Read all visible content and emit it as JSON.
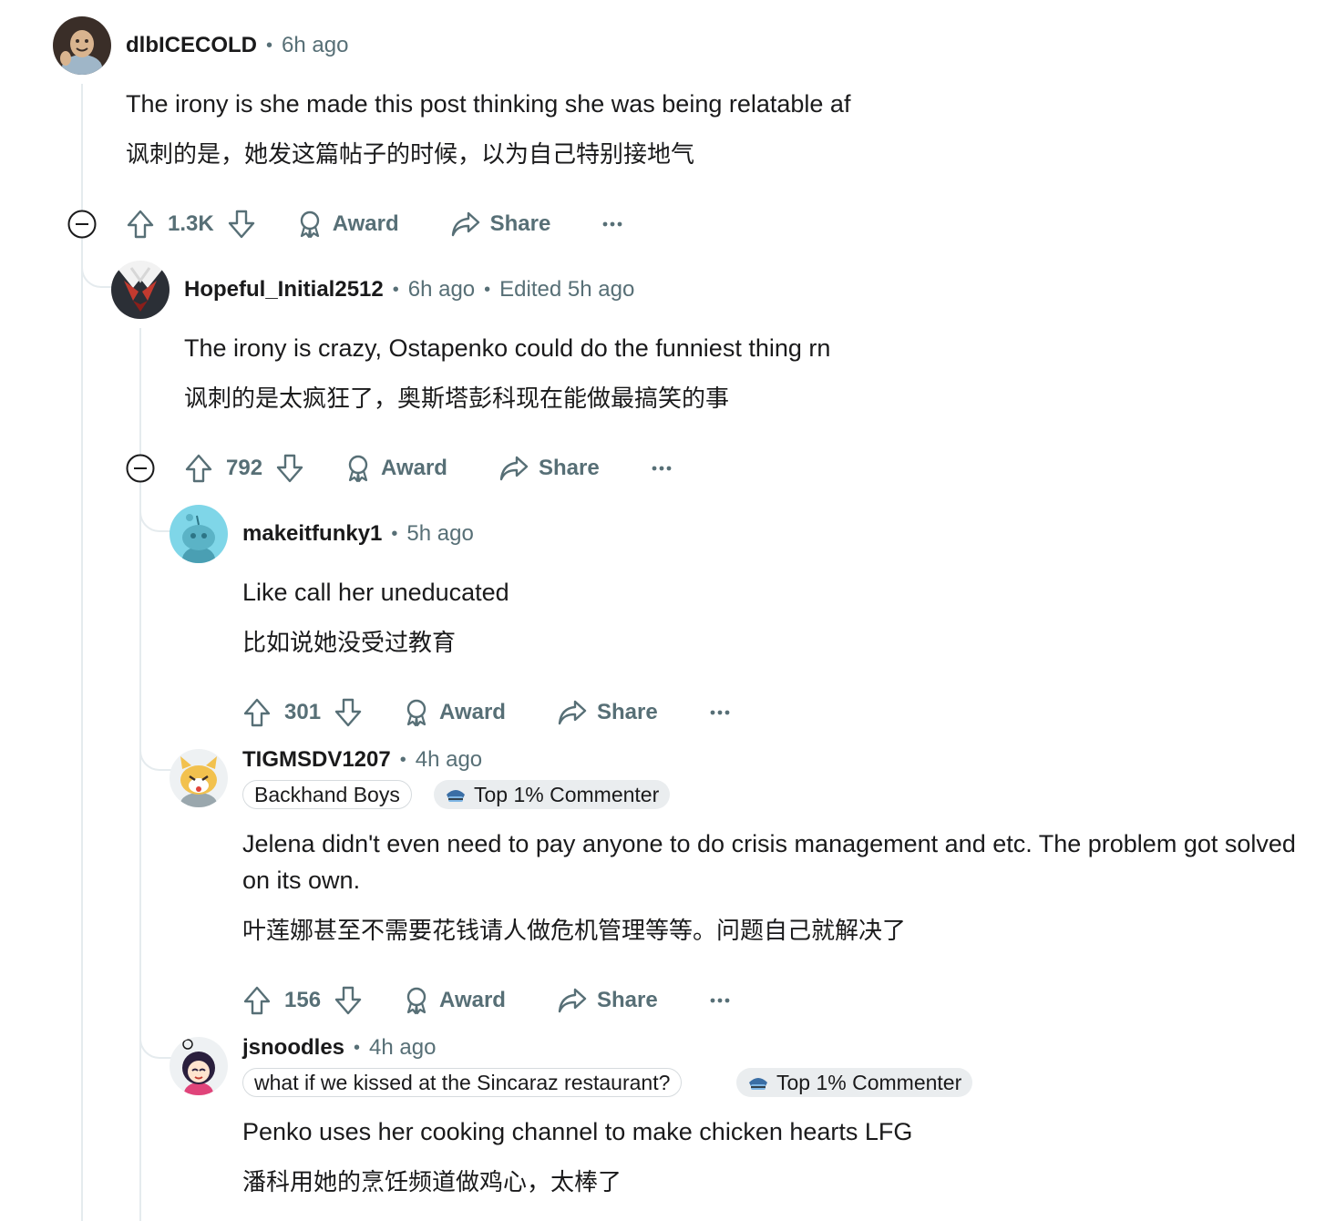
{
  "comments": [
    {
      "username": "dlbICECOLD",
      "time": "6h ago",
      "text_en": "The irony is she made this post thinking she was being relatable af",
      "text_zh": "讽刺的是，她发这篇帖子的时候，以为自己特别接地气",
      "votes": "1.3K",
      "award": "Award",
      "share": "Share"
    },
    {
      "username": "Hopeful_Initial2512",
      "time": "6h ago",
      "edited": "Edited 5h ago",
      "text_en": "The irony is crazy, Ostapenko could do the funniest thing rn",
      "text_zh": "讽刺的是太疯狂了，奥斯塔彭科现在能做最搞笑的事",
      "votes": "792",
      "award": "Award",
      "share": "Share"
    },
    {
      "username": "makeitfunky1",
      "time": "5h ago",
      "text_en": "Like call her uneducated",
      "text_zh": "比如说她没受过教育",
      "votes": "301",
      "award": "Award",
      "share": "Share"
    },
    {
      "username": "TIGMSDV1207",
      "time": "4h ago",
      "flair": "Backhand Boys",
      "badge": "Top 1% Commenter",
      "text_en": "Jelena didn't even need to pay anyone to do crisis management and etc. The problem got solved on its own.",
      "text_zh": "叶莲娜甚至不需要花钱请人做危机管理等等。问题自己就解决了",
      "votes": "156",
      "award": "Award",
      "share": "Share"
    },
    {
      "username": "jsnoodles",
      "time": "4h ago",
      "flair": "what if we kissed at the Sincaraz restaurant?",
      "badge": "Top 1% Commenter",
      "text_en": "Penko uses her cooking channel to make chicken hearts LFG",
      "text_zh": "潘科用她的烹饪频道做鸡心，太棒了"
    }
  ],
  "colors": {
    "text_primary": "#1a1a1b",
    "text_secondary": "#576f76",
    "thread_line": "#e5ebee",
    "badge_bg": "#eaedef"
  }
}
